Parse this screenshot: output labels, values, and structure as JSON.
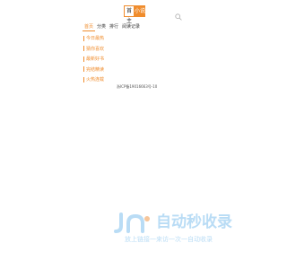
{
  "header": {
    "logo_left": "首主",
    "logo_right": "小说",
    "search_icon": "search-icon",
    "accent_color": "#f08c2c"
  },
  "nav": {
    "tabs": [
      {
        "label": "首页",
        "active": true
      },
      {
        "label": "分类",
        "active": false
      },
      {
        "label": "排行",
        "active": false
      },
      {
        "label": "阅读记录",
        "active": false
      }
    ]
  },
  "categories": [
    {
      "label": "今日最热"
    },
    {
      "label": "猜你喜欢"
    },
    {
      "label": "最新好书"
    },
    {
      "label": "完结精读"
    },
    {
      "label": "火热连载"
    }
  ],
  "footer": {
    "icp": "浙ICP备19016663号-10"
  },
  "watermark": {
    "main": "自动秒收录",
    "sub": "放上链接一来访一次一自动收录",
    "color": "#b9dcf5"
  }
}
